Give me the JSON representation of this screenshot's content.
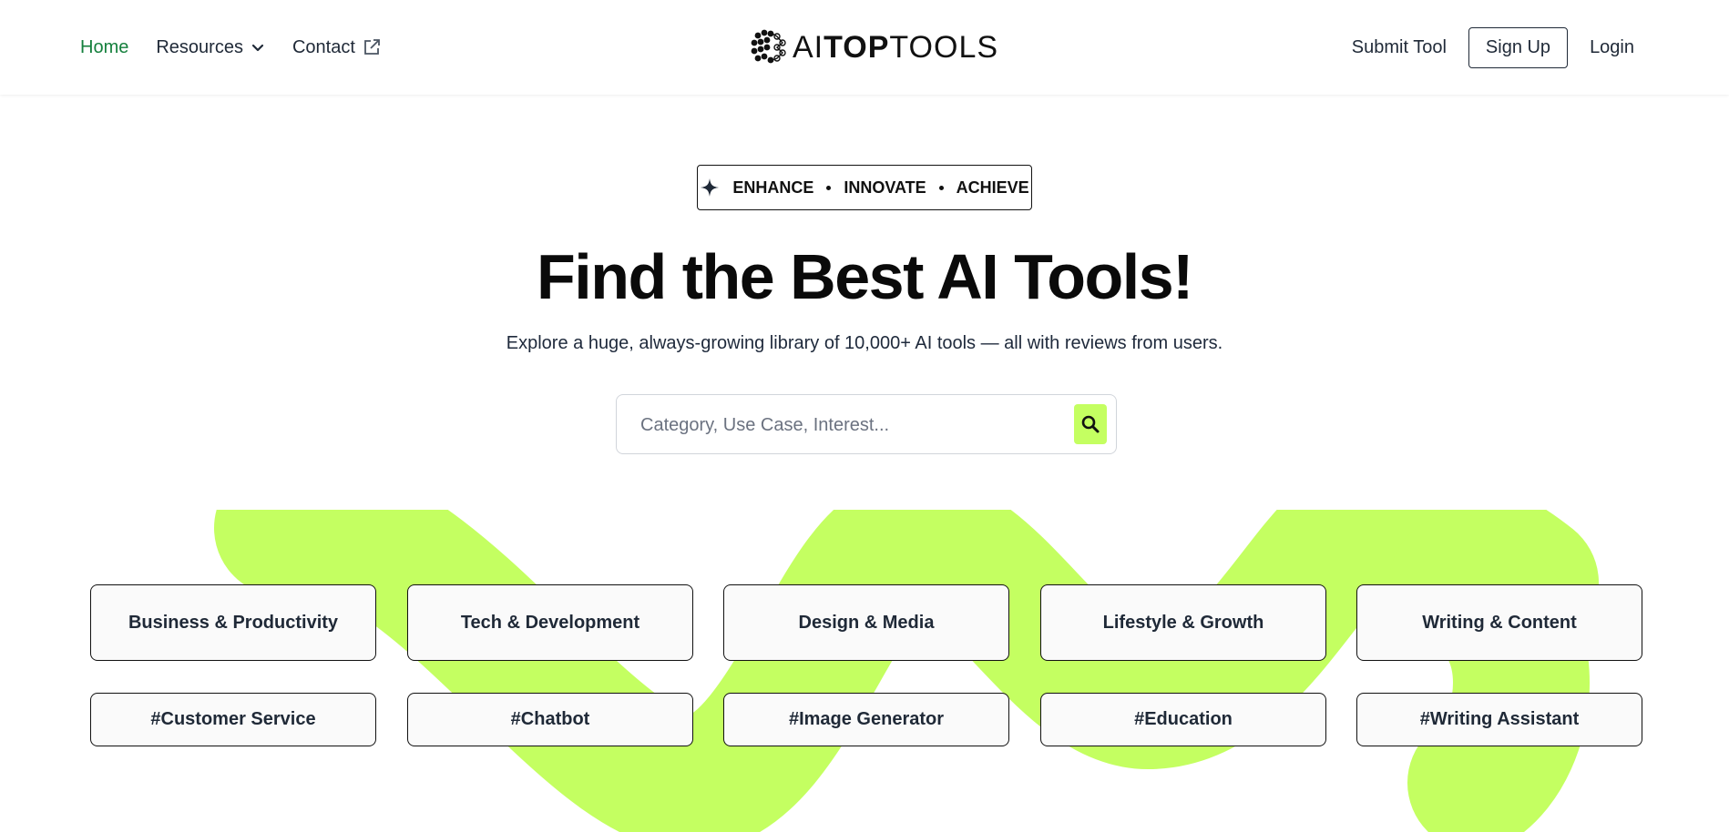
{
  "nav": {
    "home": "Home",
    "resources": "Resources",
    "contact": "Contact",
    "submit_tool": "Submit Tool",
    "sign_up": "Sign Up",
    "login": "Login"
  },
  "logo": {
    "part1": "AI",
    "part2": "TOP",
    "part3": "TOOLS"
  },
  "hero": {
    "tagline": [
      "ENHANCE",
      "INNOVATE",
      "ACHIEVE"
    ],
    "title": "Find the Best AI Tools!",
    "subtitle": "Explore a huge, always-growing library of 10,000+ AI tools — all with reviews from users."
  },
  "search": {
    "placeholder": "Category, Use Case, Interest..."
  },
  "categories": [
    "Business & Productivity",
    "Tech & Development",
    "Design & Media",
    "Lifestyle & Growth",
    "Writing & Content"
  ],
  "tags": [
    "#Customer Service",
    "#Chatbot",
    "#Image Generator",
    "#Education",
    "#Writing Assistant"
  ],
  "colors": {
    "accent": "#c4ff61",
    "active_nav": "#15803d",
    "text": "#111827"
  },
  "icons": {
    "resources": "chevron-down-icon",
    "contact": "external-link-icon",
    "tagline": "sparkle-icon",
    "search": "search-icon"
  }
}
